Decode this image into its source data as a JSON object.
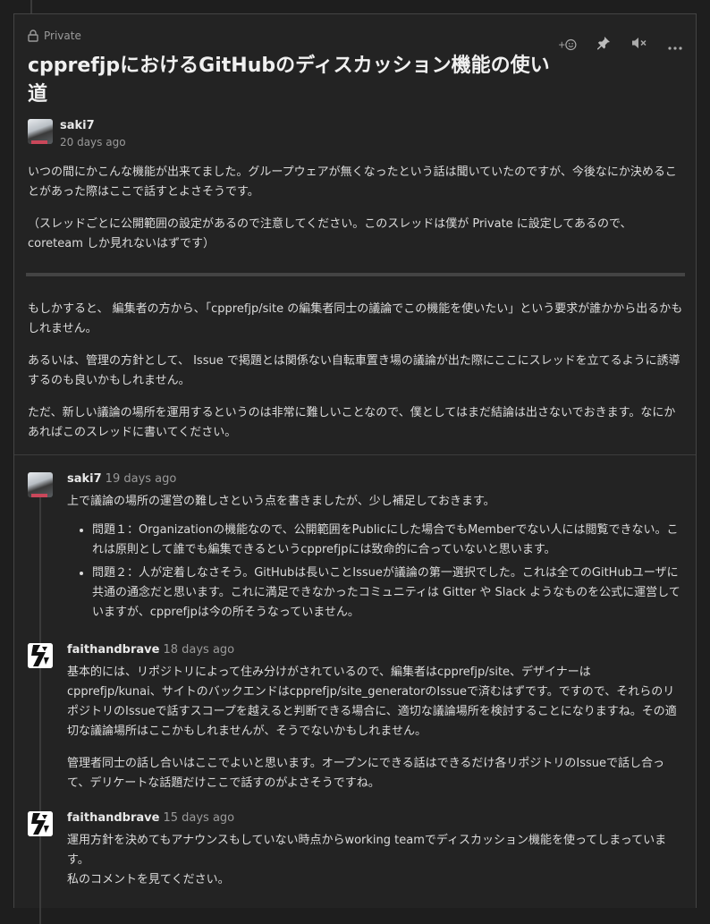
{
  "discussion": {
    "visibility_label": "Private",
    "title": "cpprefjpにおけるGitHubのディスカッション機能の使い道",
    "author": "saki7",
    "time": "20 days ago",
    "paragraphs": [
      "いつの間にかこんな機能が出来てました。グループウェアが無くなったという話は聞いていたのですが、今後なにか決めることがあった際はここで話すとよさそうです。",
      "（スレッドごとに公開範囲の設定があるので注意してください。このスレッドは僕が Private に設定してあるので、coreteam しか見れないはずです）",
      "もしかすると、 編集者の方から、「cpprefjp/site の編集者同士の議論でこの機能を使いたい」という要求が誰かから出るかもしれません。",
      "あるいは、管理の方針として、 Issue で掲題とは関係ない自転車置き場の議論が出た際にここにスレッドを立てるように誘導するのも良いかもしれません。",
      "ただ、新しい議論の場所を運用するというのは非常に難しいことなので、僕としてはまだ結論は出さないでおきます。なにかあればこのスレッドに書いてください。"
    ]
  },
  "actions": {
    "add_reaction": "+",
    "icons": [
      "add-reaction-icon",
      "pin-icon",
      "mute-icon",
      "more-icon"
    ]
  },
  "comments": [
    {
      "author": "saki7",
      "time": "19 days ago",
      "intro": "上で議論の場所の運営の難しさという点を書きましたが、少し補足しておきます。",
      "bullets": [
        "問題１：Organizationの機能なので、公開範囲をPublicにした場合でもMemberでない人には閲覧できない。これは原則として誰でも編集できるというcpprefjpには致命的に合っていないと思います。",
        "問題２：人が定着しなさそう。GitHubは長いことIssueが議論の第一選択でした。これは全てのGitHubユーザに共通の通念だと思います。これに満足できなかったコミュニティは Gitter や Slack ようなものを公式に運営していますが、cpprefjpは今の所そうなっていません。"
      ]
    },
    {
      "author": "faithandbrave",
      "time": "18 days ago",
      "paragraphs": [
        "基本的には、リポジトリによって住み分けがされているので、編集者はcpprefjp/site、デザイナーはcpprefjp/kunai、サイトのバックエンドはcpprefjp/site_generatorのIssueで済むはずです。ですので、それらのリポジトリのIssueで話すスコープを越えると判断できる場合に、適切な議論場所を検討することになりますね。その適切な議論場所はここかもしれませんが、そうでないかもしれません。",
        "管理者同士の話し合いはここでよいと思います。オープンにできる話はできるだけ各リポジトリのIssueで話し合って、デリケートな話題だけここで話すのがよさそうですね。"
      ]
    },
    {
      "author": "faithandbrave",
      "time": "15 days ago",
      "paragraphs": [
        "運用方針を決めてもアナウンスもしていない時点からworking teamでディスカッション機能を使ってしまっています。",
        "私のコメントを見てください。"
      ]
    }
  ]
}
